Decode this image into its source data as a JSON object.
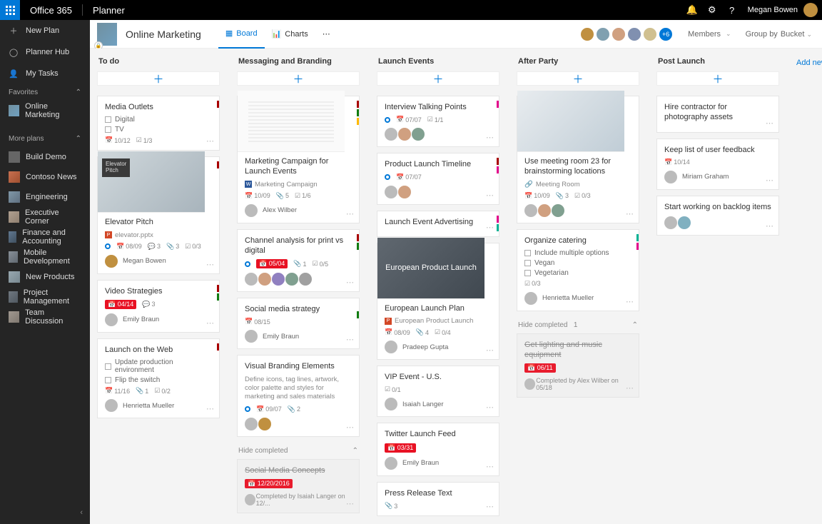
{
  "topbar": {
    "suite": "Office 365",
    "app": "Planner",
    "user": "Megan Bowen"
  },
  "leftnav": {
    "new_plan": "New Plan",
    "planner_hub": "Planner Hub",
    "my_tasks": "My Tasks",
    "favorites_label": "Favorites",
    "favorites": [
      {
        "name": "Online Marketing"
      }
    ],
    "more_plans_label": "More plans",
    "plans": [
      {
        "name": "Build Demo"
      },
      {
        "name": "Contoso News"
      },
      {
        "name": "Engineering"
      },
      {
        "name": "Executive Corner"
      },
      {
        "name": "Finance and Accounting"
      },
      {
        "name": "Mobile Development"
      },
      {
        "name": "New Products"
      },
      {
        "name": "Project Management"
      },
      {
        "name": "Team Discussion"
      }
    ]
  },
  "header": {
    "plan_title": "Online Marketing",
    "tab_board": "Board",
    "tab_charts": "Charts",
    "members_label": "Members",
    "group_by_label": "Group by",
    "group_by_value": "Bucket",
    "extra_members": "+6"
  },
  "buckets": {
    "add_new": "Add new bu",
    "b0": {
      "title": "To do",
      "c0": {
        "title": "Media Outlets",
        "check1": "Digital",
        "check2": "TV",
        "date": "10/12",
        "prog": "1/3"
      },
      "c1": {
        "title": "Elevator Pitch",
        "file": "elevator.pptx",
        "date": "08/09",
        "comments": "3",
        "attach": "3",
        "prog": "0/3",
        "assignee": "Megan Bowen",
        "imglabel1": "Elevator",
        "imglabel2": "Pitch"
      },
      "c2": {
        "title": "Video Strategies",
        "date": "04/14",
        "comments": "3",
        "assignee": "Emily Braun"
      },
      "c3": {
        "title": "Launch on the Web",
        "check1": "Update production environment",
        "check2": "Flip the switch",
        "date": "11/16",
        "attach": "1",
        "prog": "0/2",
        "assignee": "Henrietta Mueller"
      }
    },
    "b1": {
      "title": "Messaging and Branding",
      "c0": {
        "title": "Marketing Campaign for Launch Events",
        "file": "Marketing Campaign",
        "date": "10/09",
        "attach": "5",
        "prog": "1/6",
        "assignee": "Alex Wilber"
      },
      "c1": {
        "title": "Channel analysis for print vs digital",
        "date": "05/04",
        "attach": "1",
        "prog": "0/5"
      },
      "c2": {
        "title": "Social media strategy",
        "date": "08/15",
        "assignee": "Emily Braun"
      },
      "c3": {
        "title": "Visual Branding Elements",
        "desc": "Define icons, tag lines, artwork, color palette and styles for marketing and sales materials",
        "date": "09/07",
        "attach": "2"
      },
      "hide": "Hide completed",
      "c4": {
        "title": "Social Media Concepts",
        "date": "12/20/2016",
        "completed": "Completed by Isaiah Langer on 12/..."
      }
    },
    "b2": {
      "title": "Launch Events",
      "c0": {
        "title": "Interview Talking Points",
        "date": "07/07",
        "prog": "1/1"
      },
      "c1": {
        "title": "Product Launch Timeline",
        "date": "07/07"
      },
      "c2": {
        "title": "Launch Event Advertising"
      },
      "c3": {
        "title": "European Launch Plan",
        "file": "European Product Launch",
        "date": "08/09",
        "attach": "4",
        "prog": "0/4",
        "imglabel": "European Product Launch",
        "assignee": "Pradeep Gupta"
      },
      "c4": {
        "title": "VIP Event - U.S.",
        "prog": "0/1",
        "assignee": "Isaiah Langer"
      },
      "c5": {
        "title": "Twitter Launch Feed",
        "date": "03/31",
        "assignee": "Emily Braun"
      },
      "c6": {
        "title": "Press Release Text",
        "attach": "3"
      }
    },
    "b3": {
      "title": "After Party",
      "c0": {
        "title": "Use meeting room 23 for brainstorming locations",
        "room": "Meeting Room",
        "date": "10/09",
        "attach": "3",
        "prog": "0/3"
      },
      "c1": {
        "title": "Organize catering",
        "check1": "Include multiple options",
        "check2": "Vegan",
        "check3": "Vegetarian",
        "prog": "0/3",
        "assignee": "Henrietta Mueller"
      },
      "hide": "Hide completed",
      "hidecount": "1",
      "c2": {
        "title": "Get lighting and music equipment",
        "date": "06/11",
        "completed": "Completed by Alex Wilber on 05/18"
      }
    },
    "b4": {
      "title": "Post Launch",
      "c0": {
        "title": "Hire contractor for photography assets"
      },
      "c1": {
        "title": "Keep list of user feedback",
        "date": "10/14",
        "assignee": "Miriam Graham"
      },
      "c2": {
        "title": "Start working on backlog items"
      }
    }
  }
}
